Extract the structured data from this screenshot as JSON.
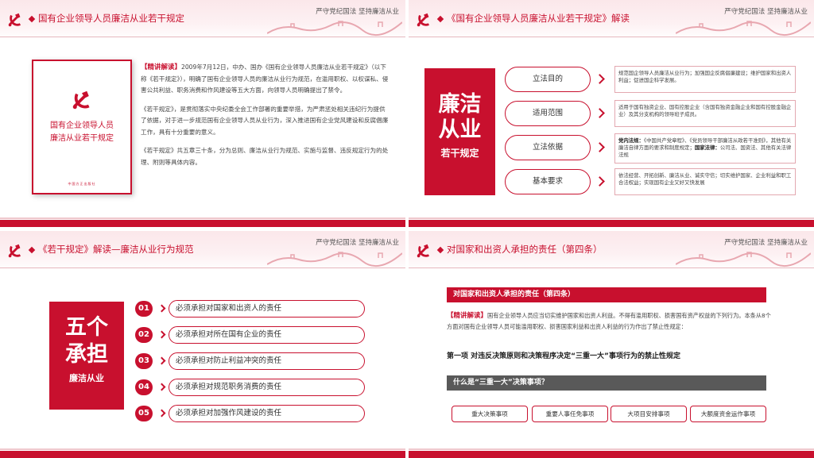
{
  "slogan": "严守党纪国法 坚持廉洁从业",
  "slide1": {
    "title": "国有企业领导人员廉洁从业若干规定",
    "book_title_1": "国有企业领导人员",
    "book_title_2": "廉洁从业若干规定",
    "book_publisher": "中国方正出版社",
    "highlight": "【精讲解读】",
    "para1": "2009年7月12日，中办、国办《国有企业领导人员廉洁从业若干规定》（以下称《若干规定》），明确了国有企业领导人员的廉洁从业行为规范，在滥用职权、以权谋私、侵害公共利益、职务消费和作风建设等五大方面，向领导人员明确提出了禁令。",
    "para2": "《若干规定》，是贯彻落实中央纪委全会工作部署的重要举措，为严肃惩处相关违纪行为提供了依据，对于进一步规范国有企业领导人员从业行为，深入推进国有企业党风建设和反腐倡廉工作，具有十分重要的意义。",
    "para3": "《若干规定》共五章三十条，分为总则、廉洁从业行为规范、实施与监督、违反规定行为的处理、附则等具体内容。"
  },
  "slide2": {
    "title": "《国有企业领导人员廉洁从业若干规定》解读",
    "box_line1": "廉洁",
    "box_line2": "从业",
    "box_line3": "若干规定",
    "items": [
      {
        "label": "立法目的",
        "desc": "规范国企领导人员廉洁从业行为；加强国企反腐倡廉建设；维护国家和出资人利益；促进国企科学发展。"
      },
      {
        "label": "适用范围",
        "desc": "适用于国有独资企业、国有控股企业（含国有独资金融企业和国有控股金融企业）及其分支机构的领导班子成员。"
      },
      {
        "label": "立法依据",
        "desc_b1": "党内法规：",
        "desc_1": "《中国共产党章程》、《党员领导干部廉洁从政若干准则》，其他有关廉洁自律方面的要求和制度规定；",
        "desc_b2": "国家法律：",
        "desc_2": "公司法、国资法、其他有关法律法规"
      },
      {
        "label": "基本要求",
        "desc": "依法经营、开拓创新、廉洁从业、诚实守信；切实维护国家、企业利益和职工合法权益；实现国有企业又好又快发展"
      }
    ]
  },
  "slide3": {
    "title": "《若干规定》解读—廉洁从业行为规范",
    "box_line1": "五个",
    "box_line2": "承担",
    "box_line3": "廉洁从业",
    "items": [
      {
        "num": "01",
        "text": "必须承担对国家和出资人的责任"
      },
      {
        "num": "02",
        "text": "必须承担对所在国有企业的责任"
      },
      {
        "num": "03",
        "text": "必须承担对防止利益冲突的责任"
      },
      {
        "num": "04",
        "text": "必须承担对规范职务消费的责任"
      },
      {
        "num": "05",
        "text": "必须承担对加强作风建设的责任"
      }
    ]
  },
  "slide4": {
    "title": "对国家和出资人承担的责任（第四条）",
    "bar_title": "对国家和出资人承担的责任（第四条）",
    "highlight": "【精讲解读】",
    "para": "国有企业领导人员应当切实维护国家和出资人利益。不得有滥用职权、损害国有资产权益的下列行为。本条从8个方面对国有企业领导人员可能滥用职权、损害国家利益和出资人利益的行为作出了禁止性规定：",
    "item1": "第一项   对违反决策原则和决策程序决定“三重一大”事项行为的禁止性规定",
    "question": "什么是“三重一大”决策事项？",
    "tags": [
      "重大决策事项",
      "重要人事任免事项",
      "大项目安排事项",
      "大额度资金运作事项"
    ]
  }
}
